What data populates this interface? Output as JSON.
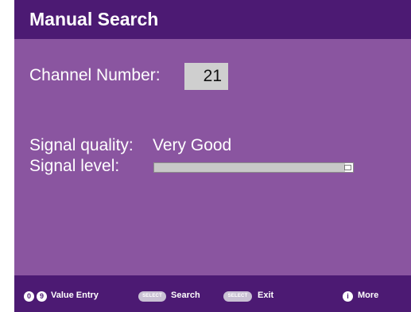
{
  "header": {
    "title": "Manual Search"
  },
  "channel": {
    "label": "Channel Number:",
    "value": "21"
  },
  "signal": {
    "quality_label": "Signal quality:",
    "quality_value": "Very Good",
    "level_label": "Signal level:",
    "level_fraction": 0.96
  },
  "footer": {
    "key_0": "0",
    "key_9": "9",
    "value_entry_label": "Value Entry",
    "select_key_1": "SELECT",
    "search_label": "Search",
    "select_key_2": "SELECT",
    "exit_label": "Exit",
    "info_key": "i",
    "more_label": "More"
  },
  "colors": {
    "background": "#8a55a0",
    "header_footer": "#4c1a73",
    "channel_box": "#cfcfcf",
    "text": "#ffffff"
  },
  "icons": {
    "info": "info-icon"
  }
}
